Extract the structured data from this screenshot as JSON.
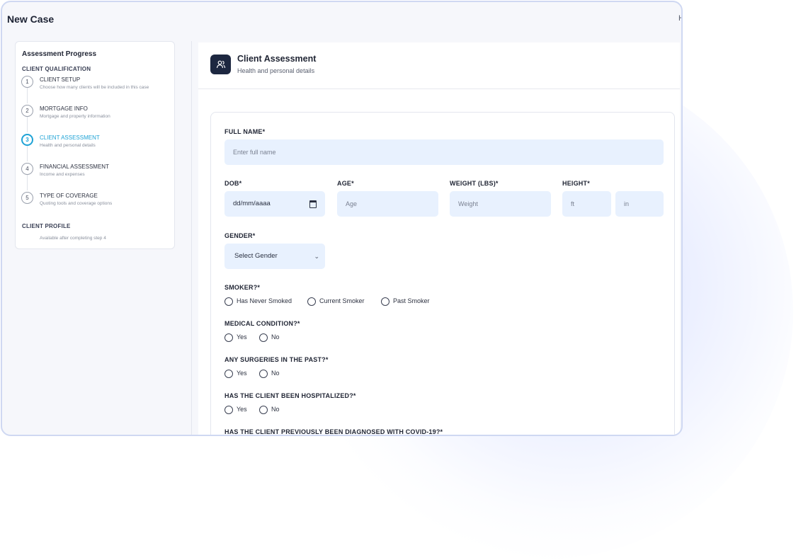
{
  "app": {
    "title": "New Case",
    "top_right": "H"
  },
  "sidebar": {
    "title": "Assessment Progress",
    "section_qualification": "CLIENT QUALIFICATION",
    "steps": [
      {
        "number": "1",
        "title": "CLIENT SETUP",
        "desc": "Choose how many clients will be included in this case",
        "active": false
      },
      {
        "number": "2",
        "title": "MORTGAGE INFO",
        "desc": "Mortgage and property information",
        "active": false
      },
      {
        "number": "3",
        "title": "CLIENT ASSESSMENT",
        "desc": "Health and personal details",
        "active": true
      },
      {
        "number": "4",
        "title": "FINANCIAL ASSESSMENT",
        "desc": "Income and expenses",
        "active": false
      },
      {
        "number": "5",
        "title": "TYPE OF COVERAGE",
        "desc": "Quoting tools and coverage options",
        "active": false
      }
    ],
    "section_profile": "CLIENT PROFILE",
    "profile_desc": "Available after completing step 4"
  },
  "header": {
    "icon": "users-icon",
    "title": "Client Assessment",
    "subtitle": "Health and personal details"
  },
  "form": {
    "full_name": {
      "label": "FULL NAME*",
      "placeholder": "Enter full name"
    },
    "dob": {
      "label": "DOB*",
      "value": "dd/mm/aaaa"
    },
    "age": {
      "label": "AGE*",
      "placeholder": "Age"
    },
    "weight": {
      "label": "WEIGHT (LBS)*",
      "placeholder": "Weight"
    },
    "height": {
      "label": "HEIGHT*",
      "ft_placeholder": "ft",
      "in_placeholder": "in"
    },
    "gender": {
      "label": "GENDER*",
      "selected": "Select Gender"
    },
    "smoker": {
      "label": "SMOKER?*",
      "options": [
        "Has Never Smoked",
        "Current Smoker",
        "Past Smoker"
      ]
    },
    "medical": {
      "label": "MEDICAL CONDITION?*",
      "options": [
        "Yes",
        "No"
      ]
    },
    "surgeries": {
      "label": "ANY SURGERIES IN THE PAST?*",
      "options": [
        "Yes",
        "No"
      ]
    },
    "hospitalized": {
      "label": "HAS THE CLIENT BEEN HOSPITALIZED?*",
      "options": [
        "Yes",
        "No"
      ]
    },
    "covid": {
      "label": "HAS THE CLIENT PREVIOUSLY BEEN DIAGNOSED WITH COVID-19?*"
    }
  },
  "colors": {
    "accent": "#1fa3d6",
    "field_bg": "#e8f1fe",
    "icon_bg": "#1d2740"
  }
}
